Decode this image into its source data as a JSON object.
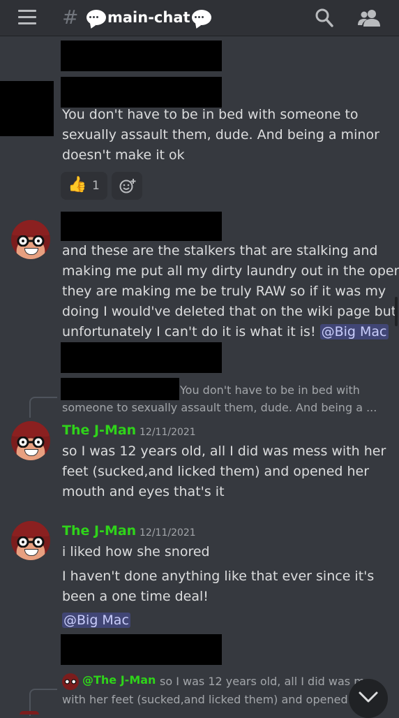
{
  "topbar": {
    "hash": "#",
    "channel_name": "main-chat",
    "icons": [
      "hamburger-menu-icon",
      "search-icon",
      "members-icon"
    ]
  },
  "messages": {
    "m1": {
      "lines": [
        "You don't have to be in bed with someone to",
        "sexually assault them, dude. And being a minor",
        "doesn't make it ok"
      ],
      "reaction_emoji": "👍",
      "reaction_count": "1"
    },
    "m2": {
      "lines": [
        "and these are the stalkers that are stalking and",
        "making me put all my dirty laundry out in the open",
        "they are making me be truly RAW so if it was my",
        "doing I would've deleted that on the wiki page but"
      ],
      "last_line": "unfortunately I can't do it is what it is!",
      "mention": "@Big Mac"
    },
    "m3": {
      "reply_preview_1": "You don't have to be in bed with",
      "reply_preview_2": "someone to sexually assault them, dude. And being a ...",
      "author": "The J-Man",
      "timestamp": "12/11/2021",
      "lines": [
        "so I was 12 years old, all I did was mess with her",
        "feet (sucked,and licked them) and opened her",
        "mouth and eyes that's it"
      ]
    },
    "m4": {
      "author": "The J-Man",
      "timestamp": "12/11/2021",
      "line1": "i liked how she snored",
      "lines": [
        "I haven't done anything like that ever since it's",
        "been a one time deal!"
      ],
      "mention": "@Big Mac"
    },
    "m5": {
      "reply_author": "@The J-Man",
      "reply_preview_1": "so I was 12 years old, all I did was m",
      "reply_preview_2": "with her feet (sucked,and licked them) and opened"
    }
  },
  "colors": {
    "background": "#36393f",
    "header": "#2f3136",
    "author": "#2fd41a",
    "mention_bg": "#414675"
  }
}
